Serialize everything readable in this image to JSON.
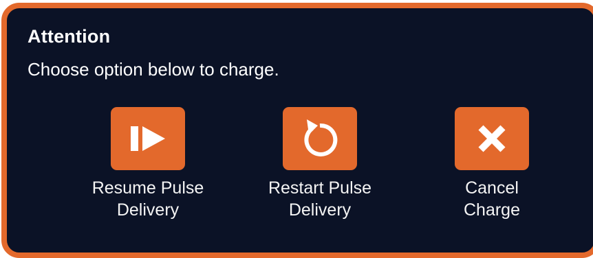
{
  "dialog": {
    "title": "Attention",
    "message": "Choose option below to charge."
  },
  "options": [
    {
      "label": "Resume Pulse\nDelivery",
      "icon": "resume-icon"
    },
    {
      "label": "Restart Pulse\nDelivery",
      "icon": "restart-icon"
    },
    {
      "label": "Cancel\nCharge",
      "icon": "close-icon"
    }
  ],
  "colors": {
    "accent": "#e3692c",
    "background": "#0b1226",
    "text": "#ffffff"
  }
}
